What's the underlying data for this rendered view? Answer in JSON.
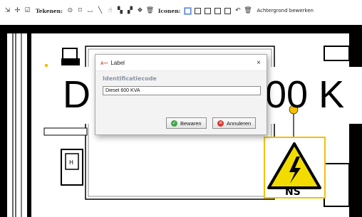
{
  "toolbar": {
    "tekenen_label": "Tekenen:",
    "iconen_label": "Iconen:",
    "background_edit": "Achtergrond bewerken"
  },
  "canvas": {
    "big_text_left": "D",
    "big_text_right": "00 K",
    "ns_label": "NS",
    "accent_color": "#f2c200"
  },
  "dialog": {
    "title": "Label",
    "close": "×",
    "field_label": "Identificatiecode",
    "field_value": "Diesel 600 KVA",
    "save_label": "Bewaren",
    "cancel_label": "Annuleren"
  }
}
